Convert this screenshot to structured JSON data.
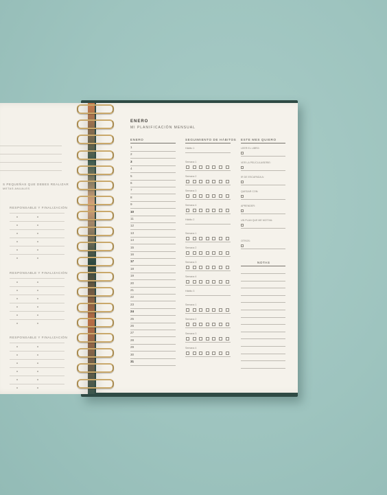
{
  "month": {
    "title": "ENERO",
    "subtitle": "MI PLANIFICACIÓN MENSUAL"
  },
  "columns": {
    "days": "ENERO",
    "habits": "SEGUIMIENTO DE HÁBITOS",
    "wants": "ESTE MES QUIERO"
  },
  "days": [
    "1",
    "2",
    "3",
    "4",
    "5",
    "6",
    "7",
    "8",
    "9",
    "10",
    "11",
    "12",
    "13",
    "14",
    "15",
    "16",
    "17",
    "18",
    "19",
    "20",
    "21",
    "22",
    "23",
    "24",
    "25",
    "26",
    "27",
    "28",
    "29",
    "30",
    "31"
  ],
  "bold_days": [
    "3",
    "10",
    "17",
    "24",
    "31"
  ],
  "habits": {
    "group_label": "Hábito",
    "week_label": "Semana",
    "groups": [
      {
        "label": "Hábito 1",
        "weeks": [
          "Semana 1",
          "Semana 2",
          "Semana 3",
          "Semana 4"
        ]
      },
      {
        "label": "Hábito 2",
        "weeks": [
          "Semana 1",
          "Semana 2",
          "Semana 3",
          "Semana 4"
        ]
      },
      {
        "label": "Hábito 3",
        "weeks": [
          "Semana 1",
          "Semana 2",
          "Semana 3",
          "Semana 4"
        ]
      }
    ]
  },
  "wants": [
    "LEER EL LIBRO:",
    "VER LA PELÍCULA/SERIE:",
    "IR DE ESCAPADA A:",
    "QUEDAR CON:",
    "APRENDER:",
    "UN PLAN QUE ME MOTIVA:",
    "OTROS:"
  ],
  "notes_label": "NOTAS",
  "left_page": {
    "hint": "S PEQUEÑAS QUE DEBES REALIZAR",
    "hint2": "METAS ANUALES",
    "section_label": "RESPONSABLE Y FINALIZACIÓN"
  }
}
